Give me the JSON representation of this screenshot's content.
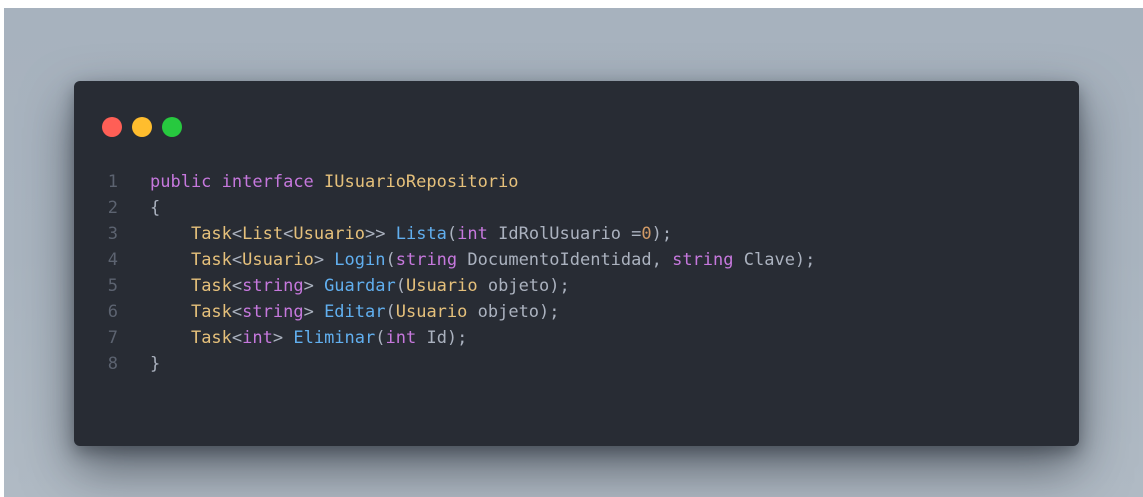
{
  "colors": {
    "window_controls": {
      "close": "#ff5f56",
      "minimize": "#ffbd2e",
      "maximize": "#27c93f"
    },
    "syntax": {
      "keyword": "#c678dd",
      "type": "#e5c07b",
      "function": "#61afef",
      "number": "#d19a66",
      "plain": "#abb2bf"
    }
  },
  "code": {
    "lines": [
      {
        "number": "1",
        "tokens": [
          {
            "text": "public",
            "kind": "keyword"
          },
          {
            "text": " ",
            "kind": "plain"
          },
          {
            "text": "interface",
            "kind": "keyword"
          },
          {
            "text": " ",
            "kind": "plain"
          },
          {
            "text": "IUsuarioRepositorio",
            "kind": "type"
          }
        ]
      },
      {
        "number": "2",
        "tokens": [
          {
            "text": "{",
            "kind": "plain"
          }
        ]
      },
      {
        "number": "3",
        "tokens": [
          {
            "text": "    ",
            "kind": "plain"
          },
          {
            "text": "Task",
            "kind": "type"
          },
          {
            "text": "<",
            "kind": "plain"
          },
          {
            "text": "List",
            "kind": "type"
          },
          {
            "text": "<",
            "kind": "plain"
          },
          {
            "text": "Usuario",
            "kind": "type"
          },
          {
            "text": ">> ",
            "kind": "plain"
          },
          {
            "text": "Lista",
            "kind": "function"
          },
          {
            "text": "(",
            "kind": "plain"
          },
          {
            "text": "int",
            "kind": "keyword"
          },
          {
            "text": " IdRolUsuario =",
            "kind": "plain"
          },
          {
            "text": "0",
            "kind": "number"
          },
          {
            "text": ");",
            "kind": "plain"
          }
        ]
      },
      {
        "number": "4",
        "tokens": [
          {
            "text": "    ",
            "kind": "plain"
          },
          {
            "text": "Task",
            "kind": "type"
          },
          {
            "text": "<",
            "kind": "plain"
          },
          {
            "text": "Usuario",
            "kind": "type"
          },
          {
            "text": "> ",
            "kind": "plain"
          },
          {
            "text": "Login",
            "kind": "function"
          },
          {
            "text": "(",
            "kind": "plain"
          },
          {
            "text": "string",
            "kind": "keyword"
          },
          {
            "text": " DocumentoIdentidad, ",
            "kind": "plain"
          },
          {
            "text": "string",
            "kind": "keyword"
          },
          {
            "text": " Clave);",
            "kind": "plain"
          }
        ]
      },
      {
        "number": "5",
        "tokens": [
          {
            "text": "    ",
            "kind": "plain"
          },
          {
            "text": "Task",
            "kind": "type"
          },
          {
            "text": "<",
            "kind": "plain"
          },
          {
            "text": "string",
            "kind": "keyword"
          },
          {
            "text": "> ",
            "kind": "plain"
          },
          {
            "text": "Guardar",
            "kind": "function"
          },
          {
            "text": "(",
            "kind": "plain"
          },
          {
            "text": "Usuario",
            "kind": "type"
          },
          {
            "text": " objeto);",
            "kind": "plain"
          }
        ]
      },
      {
        "number": "6",
        "tokens": [
          {
            "text": "    ",
            "kind": "plain"
          },
          {
            "text": "Task",
            "kind": "type"
          },
          {
            "text": "<",
            "kind": "plain"
          },
          {
            "text": "string",
            "kind": "keyword"
          },
          {
            "text": "> ",
            "kind": "plain"
          },
          {
            "text": "Editar",
            "kind": "function"
          },
          {
            "text": "(",
            "kind": "plain"
          },
          {
            "text": "Usuario",
            "kind": "type"
          },
          {
            "text": " objeto);",
            "kind": "plain"
          }
        ]
      },
      {
        "number": "7",
        "tokens": [
          {
            "text": "    ",
            "kind": "plain"
          },
          {
            "text": "Task",
            "kind": "type"
          },
          {
            "text": "<",
            "kind": "plain"
          },
          {
            "text": "int",
            "kind": "keyword"
          },
          {
            "text": "> ",
            "kind": "plain"
          },
          {
            "text": "Eliminar",
            "kind": "function"
          },
          {
            "text": "(",
            "kind": "plain"
          },
          {
            "text": "int",
            "kind": "keyword"
          },
          {
            "text": " Id);",
            "kind": "plain"
          }
        ]
      },
      {
        "number": "8",
        "tokens": [
          {
            "text": "}",
            "kind": "plain"
          }
        ]
      }
    ]
  }
}
